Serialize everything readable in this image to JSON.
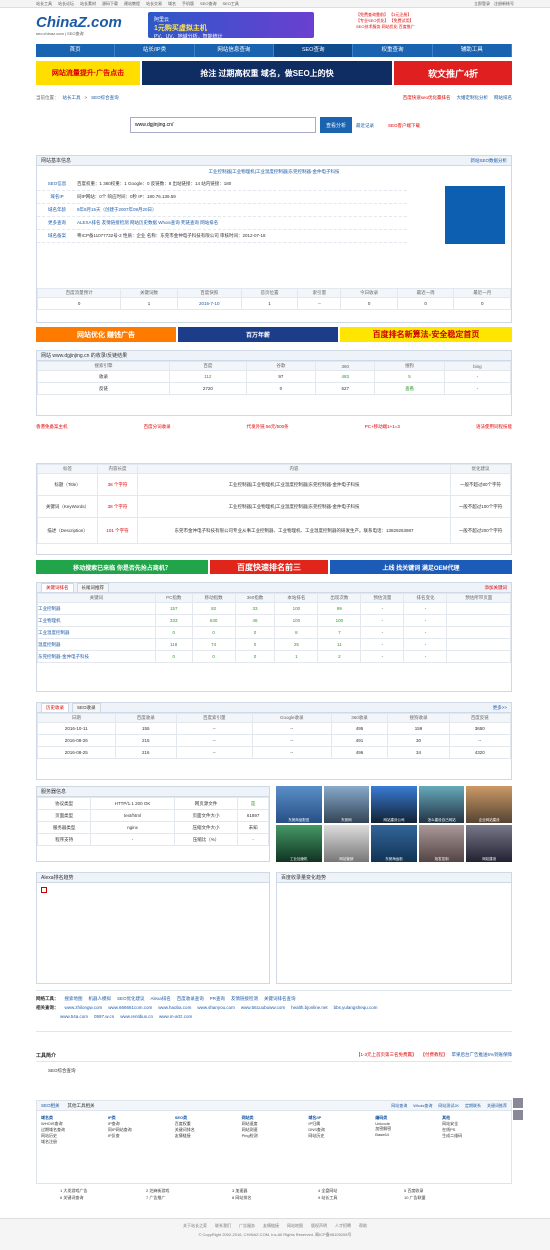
{
  "topbar": {
    "left": [
      "站长工具",
      "站长论坛",
      "站长素材",
      "源码下载",
      "建站教程",
      "站长交易",
      "域名",
      "手机版",
      "SEO查询",
      "SEO工具"
    ],
    "right": [
      "立即登录",
      "注册新帐号"
    ]
  },
  "logo": {
    "title": "ChinaZ.com",
    "sub": "seo.chinaz.com | SEO查询"
  },
  "header_ad": {
    "line1": "阿里云",
    "line2": "1元购买虚拟主机",
    "line3": "PV、UV、地域分析，智能统计"
  },
  "header_links": [
    "【免费查询靠前】",
    "【3元注册】",
    "【专业SEO优化】",
    "【免费试用】",
    "SEO技术服务",
    "网站优化",
    "百度推广"
  ],
  "nav": [
    "首页",
    "站长/IP类",
    "网站信息查询",
    "SEO查询",
    "权重查询",
    "辅助工具"
  ],
  "ads_top": [
    "网站流量提升·广告点击",
    "抢注 过期高权重 域名，做SEO上的快",
    "软文推广4折"
  ],
  "crumb": {
    "a": "当前位置：",
    "b": "站长工具",
    "c": "SEO综合查询",
    "links": [
      "百度快速seo优化赢排名",
      "大婚定制化分析",
      "网站排名"
    ]
  },
  "search": {
    "value": "www.dgjinjing.cn/",
    "button": "查看分析",
    "recent": "最近记录",
    "hint": "SEO客户端下载"
  },
  "basic": {
    "title": "网站基本信息",
    "more": "新站SEO数据分析",
    "site_title": "工业控制器|工业物理机|工业温度控制器|东莞控制器-金仲电子科技",
    "rows": [
      {
        "k": "SEO信息",
        "v": "百度权重：1  360权重：1  Google：0  反链数：8  出站链接：14  站内链接：180"
      },
      {
        "k": "域名IP",
        "v": "同IP网站：0个  响应时间：0秒  IP：180.76.139.59"
      },
      {
        "k": "域名年龄",
        "v": "9年8月15天（创建于2007年09月20日）"
      },
      {
        "k": "更多查询",
        "v": "ALEXA排名  友情链接检测  网站历史数据  Whois查询  死链查询  网站排名"
      },
      {
        "k": "域名备案",
        "v": "粤ICP备11077732号-2  性质：企业  名称：东莞市金仲电子科技有限公司  审核时间：2012-07-18"
      }
    ],
    "cols": [
      "百度流量预计",
      "关键词数",
      "百度快照",
      "首页位置",
      "索引量",
      "今日收录",
      "最近一周",
      "最近一月"
    ],
    "vals": [
      "0",
      "1",
      "2016-7-10",
      "1",
      "--",
      "0",
      "0",
      "0"
    ]
  },
  "ads_mid": [
    "网站优化 赚钱广告",
    "百万年薪",
    "百度排名新算法-安全稳定首页"
  ],
  "index": {
    "title": "网站 www.dgjinjing.cn 的收录/反链结果",
    "cols": [
      "搜索引擎",
      "百度",
      "谷歌",
      "360",
      "搜狗",
      "bing"
    ],
    "r1": [
      "收录",
      "112",
      "97",
      "483",
      "5",
      "-"
    ],
    "r2": [
      "反链",
      "2720",
      "0",
      "527",
      "查看",
      "-"
    ]
  },
  "redlinks": [
    "香港免备案主机",
    "百度分词收录",
    "代发外链 56元/500条",
    "PC+移动端1+1=3",
    "语法使用同程技能"
  ],
  "meta": {
    "cols": [
      "标签",
      "内容长度",
      "内容",
      "优化建议"
    ],
    "rows": [
      {
        "k": "标题（Title）",
        "len": "38 个字符",
        "c": "工业控制器|工业物理机|工业温度控制器|东莞控制器-金仲电子科技",
        "s": "一般不超过80个字符"
      },
      {
        "k": "关键词（KeyWords）",
        "len": "38 个字符",
        "c": "工业控制器|工业物理机|工业温度控制器|东莞控制器-金仲电子科技",
        "s": "一般不超过100个字符"
      },
      {
        "k": "描述（Description）",
        "len": "101 个字符",
        "c": "东莞市金仲电子科技有限公司专业从事工业控制器、工业物理机、工业温度控制器的研发生产。联系电话：13829263987",
        "s": "一般不超过200个字符"
      }
    ]
  },
  "ads_mid2": [
    "移动搜索已来临 你是否先抢占商机？",
    "百度快速排名前三",
    "上线 找关键词 满足OEM代理"
  ],
  "kw": {
    "tabs": [
      "关键词排名",
      "长尾词推荐"
    ],
    "add": "添加关键词",
    "cols": [
      "关键词",
      "PC指数",
      "移动指数",
      "360指数",
      "本站排名",
      "出现次数",
      "预估流量",
      "排名变化",
      "预估所带页面"
    ],
    "rows": [
      [
        "工业控制器",
        "157",
        "82",
        "33",
        "100",
        "99",
        "-",
        "-"
      ],
      [
        "工业物理机",
        "333",
        "630",
        "46",
        "100",
        "100",
        "-",
        "-"
      ],
      [
        "工业温度控制器",
        "0",
        "0",
        "0",
        "8",
        "7",
        "-",
        "-"
      ],
      [
        "温度控制器",
        "118",
        "74",
        "0",
        "25",
        "11",
        "-",
        "-"
      ],
      [
        "东莞控制器-金仲电子科技",
        "0",
        "0",
        "0",
        "1",
        "2",
        "-",
        "-"
      ]
    ]
  },
  "hist": {
    "tabs": [
      "历史收录",
      "SEO收录"
    ],
    "more": "更多>>",
    "cols": [
      "日期",
      "百度收录",
      "百度索引量",
      "Google收录",
      "360收录",
      "搜狗收录",
      "百度反链"
    ],
    "rows": [
      [
        "2016-10-11",
        "155",
        "--",
        "--",
        "495",
        "159",
        "3650"
      ],
      [
        "2016-08-26",
        "215",
        "--",
        "--",
        "491",
        "30",
        "--"
      ],
      [
        "2016-08-25",
        "216",
        "--",
        "--",
        "496",
        "34",
        "4320"
      ]
    ]
  },
  "server": {
    "title": "服务器信息",
    "rows": [
      [
        "协议类型",
        "HTTP/1.1 200 OK",
        "网页源文件",
        "是"
      ],
      [
        "页面类型",
        "text/html",
        "页面文件大小",
        "61897"
      ],
      [
        "服务器类型",
        "nginx",
        "压缩文件大小",
        "未知"
      ],
      [
        "程序支持",
        "-",
        "压缩比（%）",
        "-"
      ]
    ],
    "thumbs": [
      "东莞商品配送",
      "东莞网",
      "网站建设公司",
      "怎么建设自己网站",
      "企业网站建设",
      "工业加速机",
      "网站营销",
      "东莞海运柜",
      "批发控制",
      "网站建设"
    ]
  },
  "alexa": {
    "title": "Alexa排名趋势"
  },
  "baidu_trend": {
    "title": "百度收录量变化趋势"
  },
  "tools": {
    "label1": "网络工具：",
    "items1": [
      "搜索地图",
      "机器人模拟",
      "SEO优化建议",
      "Alexa排名",
      "百度收录查询",
      "PR查询",
      "友情链接检测",
      "关键词排名查询"
    ],
    "label2": "相关查询：",
    "items2": [
      "www.zhilongw.com",
      "www.666661com.com",
      "www.haoba.com",
      "www.shanyou.com",
      "www.561uubuww.com",
      "health.bjonline.net",
      "bbs.yulangshequ.com"
    ],
    "items3": [
      "www.54a.com",
      "0597.w.cn",
      "www.rentibus.cn",
      "www.m-artz.com"
    ]
  },
  "intro": {
    "title": "工具简介",
    "body": "SEO综合查询",
    "links": [
      "【1-3元上首页第三名免费赢】",
      "【付费教程】",
      "苹果后台广告推送5%到账保障"
    ]
  },
  "foot": {
    "tabs": [
      "SEO相关",
      "其他工具相关"
    ],
    "links": [
      "网站查询",
      "Whois查询",
      "网站测试JK",
      "定期联系",
      "关键词推荐"
    ],
    "cols": [
      [
        "域名类",
        "WHOIS查询",
        "过期域名查询",
        "网站历史",
        "域名注册"
      ],
      [
        "IP类",
        "IP查询",
        "同IP网站查询",
        "IP反查"
      ],
      [
        "SEO类",
        "百度权重",
        "关键词排名",
        "友情链接"
      ],
      [
        "网站类",
        "网站速度",
        "网站测速",
        "Ping检测"
      ],
      [
        "域名/IP",
        "IP归属",
        "DNS查询",
        "网站历史"
      ],
      [
        "编码类",
        "Unicode",
        "加密解密",
        "Base64"
      ],
      [
        "其他",
        "网站安全",
        "在线PS",
        "生成二维码"
      ]
    ],
    "ranks": [
      "1 大发游戏广告",
      "2 芝麻街游戏",
      "3 加速器",
      "4 全盘网站",
      "5 百度收录",
      "6 关键词查询",
      "7 广告推广",
      "8 网站排名",
      "9 站长工具",
      "10 广告联盟"
    ],
    "bottom": [
      "关于站长之家",
      "联系我们",
      "广告服务",
      "友情链接",
      "网站地图",
      "版权声明",
      "人才招聘",
      "帮助"
    ],
    "copy": "© CopyRight 2002-2016, CHINAZ.COM, Inc.All Rights Reserved. 闽ICP备08105208号"
  }
}
